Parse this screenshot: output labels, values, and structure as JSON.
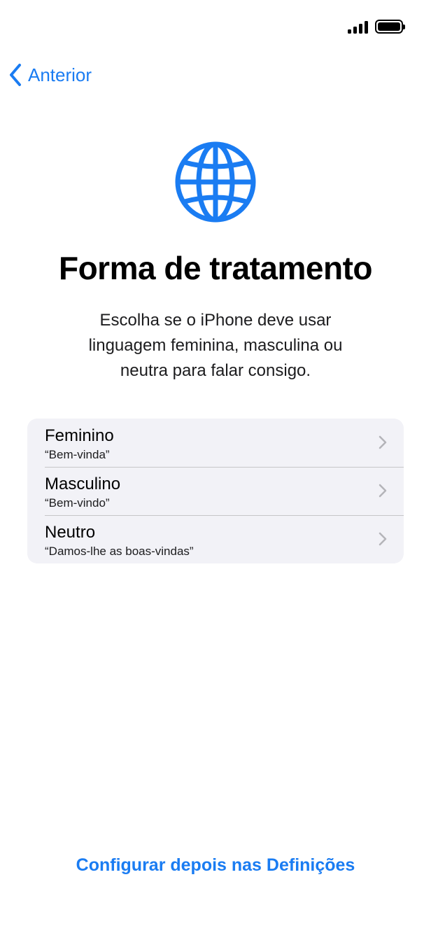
{
  "colors": {
    "accent": "#1a7cf2",
    "list_background": "#f2f2f7",
    "separator": "#c6c6c8"
  },
  "status_bar": {
    "icons": [
      "signal-icon",
      "battery-icon"
    ]
  },
  "navigation": {
    "back_label": "Anterior",
    "back_icon": "chevron-left-icon"
  },
  "header": {
    "icon": "globe-icon",
    "title": "Forma de tratamento",
    "description": "Escolha se o iPhone deve usar linguagem feminina, masculina ou neutra para falar consigo."
  },
  "options": [
    {
      "title": "Feminino",
      "subtitle": "“Bem-vinda”"
    },
    {
      "title": "Masculino",
      "subtitle": "“Bem-vindo”"
    },
    {
      "title": "Neutro",
      "subtitle": "“Damos-lhe as boas-vindas”"
    }
  ],
  "footer": {
    "configure_later_label": "Configurar depois nas Definições"
  }
}
